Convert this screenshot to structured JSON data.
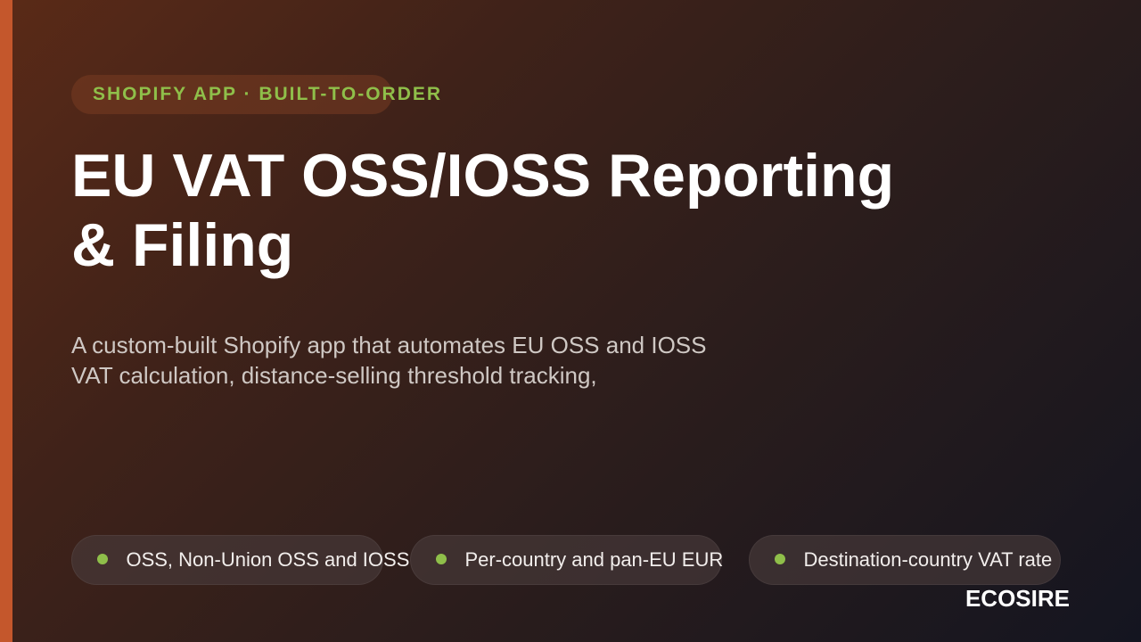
{
  "tag": {
    "label": "SHOPIFY APP · BUILT-TO-ORDER"
  },
  "title": {
    "line1": "EU VAT OSS/IOSS Reporting",
    "line2": "& Filing"
  },
  "subtitle": {
    "line1": "A custom-built Shopify app that automates EU OSS and IOSS",
    "line2": "VAT calculation, distance-selling threshold tracking,"
  },
  "features": [
    {
      "label": "OSS, Non-Union OSS and IOSS",
      "icon": "bullet-dot-icon"
    },
    {
      "label": "Per-country and pan-EU EUR",
      "icon": "bullet-dot-icon"
    },
    {
      "label": "Destination-country VAT rate",
      "icon": "bullet-dot-icon"
    }
  ],
  "brand": {
    "name": "ECOSIRE"
  },
  "colors": {
    "accent_bar": "#c4572c",
    "tag_text": "#8fbf4a",
    "bullet": "#8fbf4a"
  }
}
